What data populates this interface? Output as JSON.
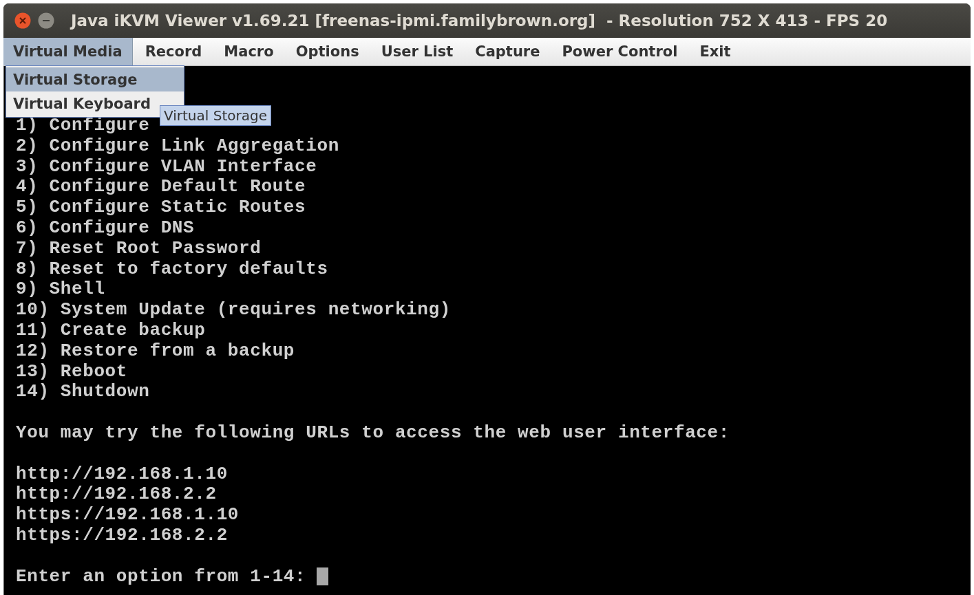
{
  "window": {
    "title": "Java iKVM Viewer v1.69.21 [freenas-ipmi.familybrown.org]  - Resolution 752 X 413 - FPS 20"
  },
  "menu_bar": [
    {
      "label": "Virtual Media",
      "selected": true
    },
    {
      "label": "Record",
      "selected": false
    },
    {
      "label": "Macro",
      "selected": false
    },
    {
      "label": "Options",
      "selected": false
    },
    {
      "label": "User List",
      "selected": false
    },
    {
      "label": "Capture",
      "selected": false
    },
    {
      "label": "Power Control",
      "selected": false
    },
    {
      "label": "Exit",
      "selected": false
    }
  ],
  "dropdown": [
    {
      "label": "Virtual Storage",
      "selected": true
    },
    {
      "label": "Virtual Keyboard",
      "selected": false
    }
  ],
  "tooltip": "Virtual Storage",
  "terminal": {
    "lines": [
      "1) Configure",
      "2) Configure Link Aggregation",
      "3) Configure VLAN Interface",
      "4) Configure Default Route",
      "5) Configure Static Routes",
      "6) Configure DNS",
      "7) Reset Root Password",
      "8) Reset to factory defaults",
      "9) Shell",
      "10) System Update (requires networking)",
      "11) Create backup",
      "12) Restore from a backup",
      "13) Reboot",
      "14) Shutdown"
    ],
    "message": "You may try the following URLs to access the web user interface:",
    "urls": [
      "http://192.168.1.10",
      "http://192.168.2.2",
      "https://192.168.1.10",
      "https://192.168.2.2"
    ],
    "prompt": "Enter an option from 1-14:"
  }
}
